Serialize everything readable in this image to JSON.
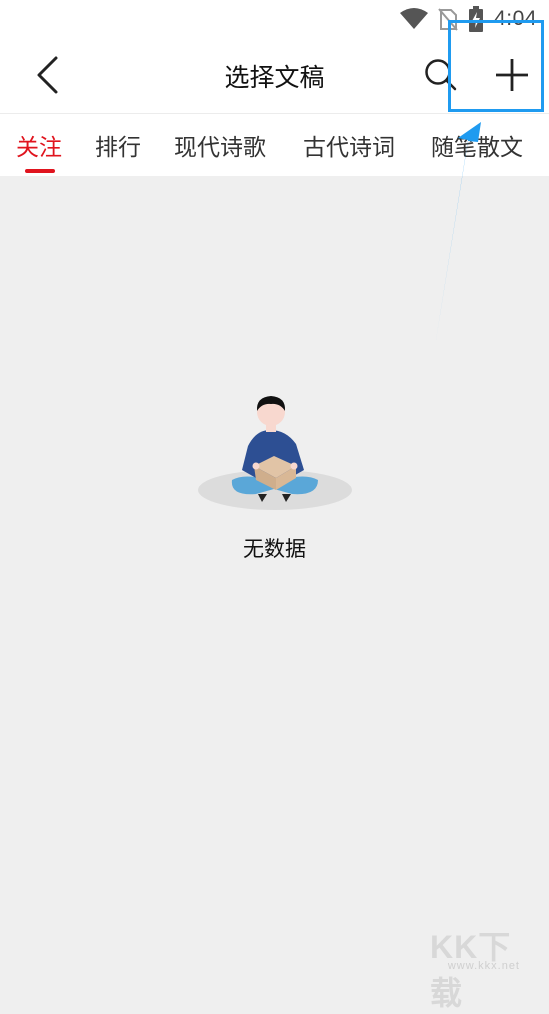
{
  "status_bar": {
    "time": "4:04",
    "icons": [
      "wifi-icon",
      "no-sim-icon",
      "battery-charging-icon"
    ]
  },
  "header": {
    "title": "选择文稿",
    "back_icon": "back-arrow-icon",
    "search_icon": "search-icon",
    "add_icon": "plus-icon"
  },
  "tabs": [
    {
      "label": "关注",
      "active": true
    },
    {
      "label": "排行",
      "active": false
    },
    {
      "label": "现代诗歌",
      "active": false
    },
    {
      "label": "古代诗词",
      "active": false
    },
    {
      "label": "随笔散文",
      "active": false
    }
  ],
  "empty_state": {
    "message": "无数据",
    "illustration": "person-with-box-illustration"
  },
  "annotation": {
    "highlight_color": "#1f9bf0",
    "arrow_color": "#1f9bf0"
  },
  "watermark": {
    "logo": "KK下载",
    "url": "www.kkx.net"
  },
  "colors": {
    "accent": "#e0141e",
    "background": "#efefef"
  }
}
